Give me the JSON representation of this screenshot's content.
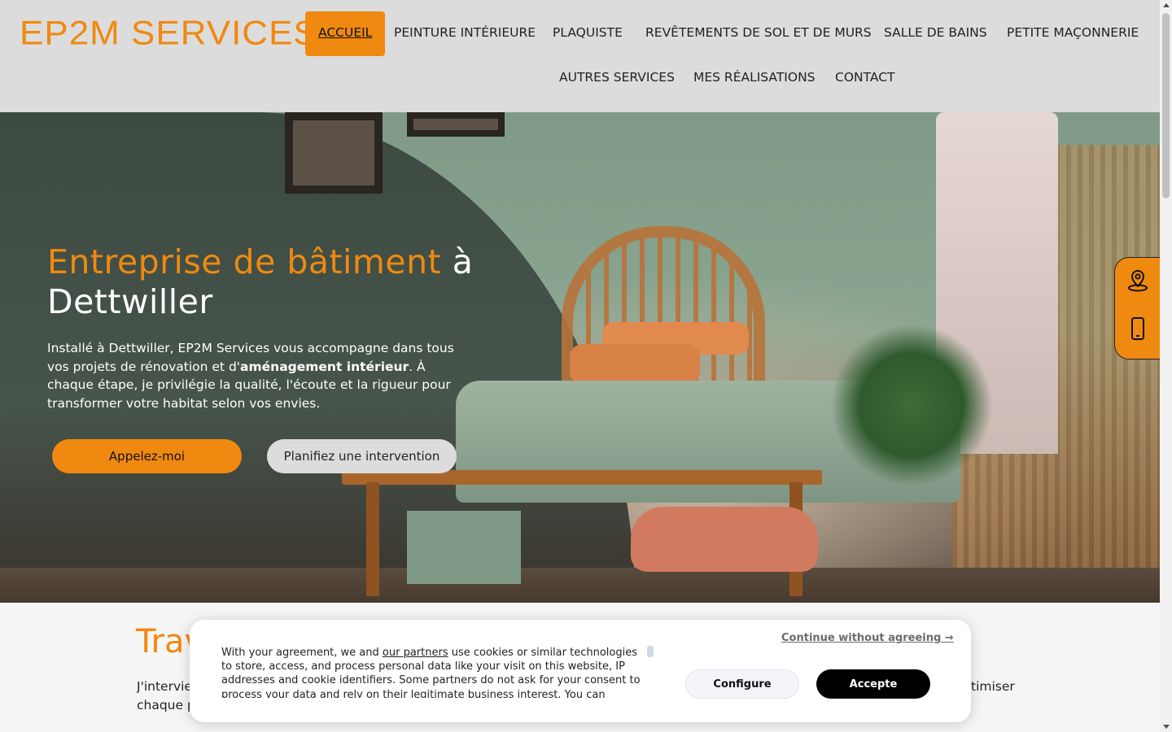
{
  "header": {
    "logo": "EP2M SERVICES",
    "nav": [
      {
        "label": "ACCUEIL",
        "active": true
      },
      {
        "label": "PEINTURE INTÉRIEURE"
      },
      {
        "label": "PLAQUISTE"
      },
      {
        "label": "REVÊTEMENTS DE SOL ET DE MURS"
      },
      {
        "label": "SALLE DE BAINS"
      },
      {
        "label": "PETITE MAÇONNERIE"
      },
      {
        "label": "AUTRES SERVICES"
      },
      {
        "label": "MES RÉALISATIONS"
      },
      {
        "label": "CONTACT"
      }
    ]
  },
  "hero": {
    "title_accent": "Entreprise de bâtiment",
    "title_plain_1": " à",
    "title_plain_2": "Dettwiller",
    "text_1": "Installé à Dettwiller, EP2M Services vous accompagne dans tous vos projets de rénovation et d'",
    "text_bold": "aménagement intérieur",
    "text_2": ". À chaque étape, je privilégie la qualité, l'écoute et la rigueur pour transformer votre habitat selon vos envies.",
    "btn_call": "Appelez-moi",
    "btn_plan": "Planifiez une intervention"
  },
  "side_panel": {
    "icons": [
      "location-pin-icon",
      "smartphone-icon"
    ]
  },
  "section": {
    "title": "Trav",
    "text_line1": "J'intervie",
    "text_line2": "chaque p",
    "text_right": "timiser"
  },
  "cookie": {
    "text_before_link": "With your agreement, we and ",
    "link": "our partners",
    "text_after_link": " use cookies or similar technologies to store, access, and process personal data like your visit on this website, IP addresses and cookie identifiers. Some partners do not ask for your consent to process your data and rely on their legitimate business interest. You can",
    "continue": "Continue without agreeing →",
    "configure": "Configure",
    "accept": "Accepte"
  },
  "colors": {
    "accent": "#f0890f",
    "header_bg": "#dcdcdc",
    "button_dark": "#000000"
  }
}
